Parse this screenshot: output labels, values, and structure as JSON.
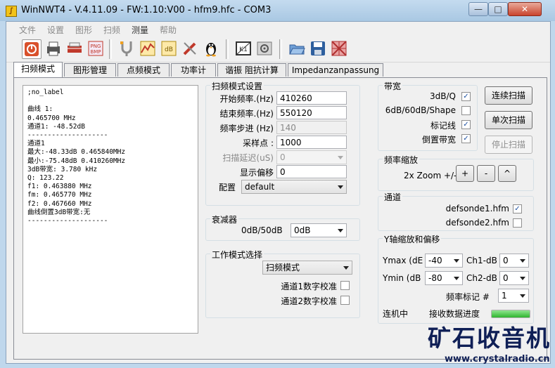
{
  "window": {
    "app_icon_glyph": "∫",
    "title": "WinNWT4 - V.4.11.09 - FW:1.10:V00 - hfm9.hfc - COM3",
    "min_glyph": "—",
    "max_glyph": "□",
    "close_glyph": "✕"
  },
  "menu": [
    "文件",
    "设置",
    "图形",
    "扫频",
    "测量",
    "帮助"
  ],
  "toolbar_icons": [
    "power-icon",
    "printer-icon",
    "print-preview-icon",
    "png-bmp-icon",
    "tuning-fork-icon",
    "graph-icon",
    "db-icon",
    "screwdriver-icon",
    "linux-penguin-icon",
    "k1-icon",
    "settings-icon",
    "open-folder-icon",
    "save-icon",
    "grid-icon"
  ],
  "tabs": [
    "扫频模式",
    "图形管理",
    "点频模式",
    "功率计",
    "谐振 阻抗计算",
    "Impedanzanpassung"
  ],
  "output_text": ";no_label\n\n曲线 1:\n0.465700 MHz\n通道1: -48.52dB\n--------------------\n通道1\n最大:-48.33dB 0.465840MHz\n最小:-75.48dB 0.410260MHz\n3dB带宽: 3.780 kHz\nQ: 123.22\nf1: 0.463880 MHz\nfm: 0.465770 MHz\nf2: 0.467660 MHz\n曲线倒置3dB带宽:无\n--------------------",
  "sweep_settings": {
    "title": "扫频模式设置",
    "start_label": "开始频率.(Hz)",
    "start_value": "410260",
    "end_label": "结束频率.(Hz)",
    "end_value": "550120",
    "step_label": "频率步进 (Hz)",
    "step_value": "140",
    "points_label": "采样点 :",
    "points_value": "1000",
    "delay_label": "扫描延迟(uS)",
    "delay_value": "0",
    "offset_label": "显示偏移",
    "offset_value": "0",
    "config_label": "配置",
    "config_value": "default"
  },
  "attenuator": {
    "title": "衰减器",
    "label": "0dB/50dB",
    "value": "0dB"
  },
  "work_mode": {
    "title": "工作模式选择",
    "value": "扫频模式",
    "ch1_label": "通道1数字校准",
    "ch2_label": "通道2数字校准"
  },
  "bandwidth": {
    "title": "带宽",
    "q3db_label": "3dB/Q",
    "q3db_checked": "✓",
    "shape_label": "6dB/60dB/Shape",
    "shape_checked": "",
    "marker_label": "标记线",
    "marker_checked": "✓",
    "inverted_label": "倒置带宽",
    "inverted_checked": "✓"
  },
  "buttons": {
    "continuous": "连续扫描",
    "single": "单次扫描",
    "stop": "停止扫描"
  },
  "freq_zoom": {
    "title": "频率缩放",
    "label": "2x Zoom +/-",
    "plus": "+",
    "minus": "-",
    "caret": "^"
  },
  "channels": {
    "title": "通道",
    "ch1_label": "defsonde1.hfm",
    "ch1_checked": "✓",
    "ch2_label": "defsonde2.hfm",
    "ch2_checked": ""
  },
  "y_axis": {
    "title": "Y轴缩放和偏移",
    "ymax_label": "Ymax (dE",
    "ymax_value": "-40",
    "ymin_label": "Ymin (dB",
    "ymin_value": "-80",
    "ch1db_label": "Ch1-dB",
    "ch1db_value": "0",
    "ch2db_label": "Ch2-dB",
    "ch2db_value": "0",
    "marker_label": "频率标记 #",
    "marker_value": "1"
  },
  "status": {
    "connected": "连机中",
    "receiving": "接收数据进度",
    "progress": 1.0
  },
  "watermark": {
    "brand": "矿石收音机",
    "url": "www.crystalradio.cn"
  }
}
